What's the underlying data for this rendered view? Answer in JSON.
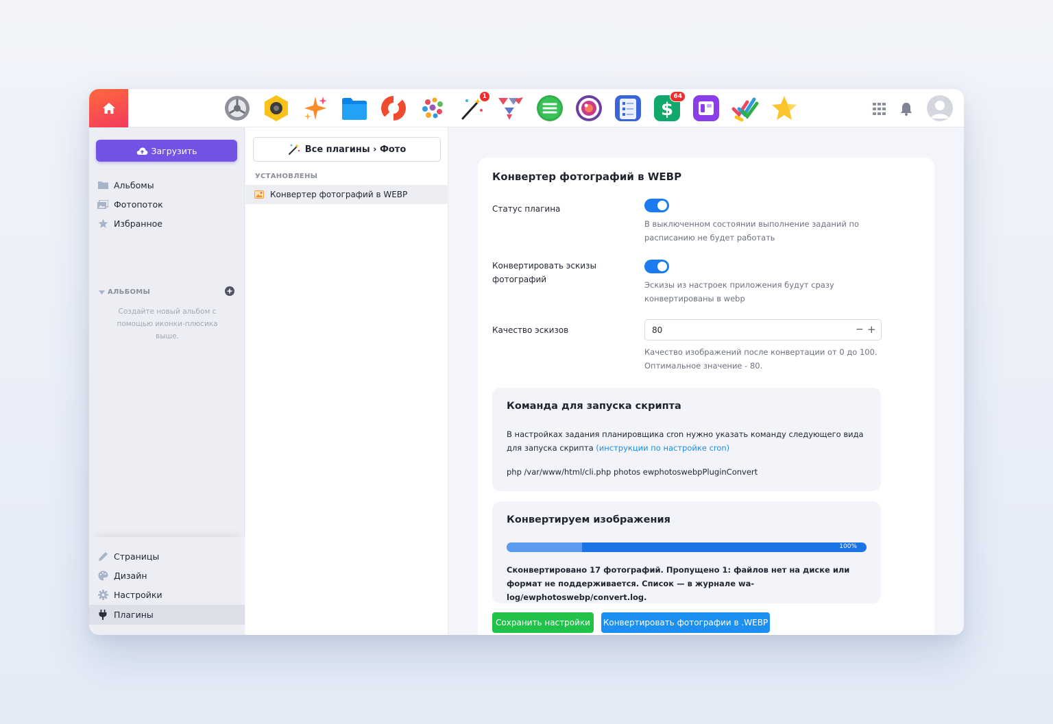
{
  "topbar": {
    "apps": [
      {
        "name": "settings-app-icon",
        "badge": ""
      },
      {
        "name": "camera-app-icon",
        "badge": ""
      },
      {
        "name": "sparkle-app-icon",
        "badge": ""
      },
      {
        "name": "files-app-icon",
        "badge": ""
      },
      {
        "name": "help-lifebuoy-app-icon",
        "badge": ""
      },
      {
        "name": "mosaic-app-icon",
        "badge": ""
      },
      {
        "name": "magic-wand-app-icon",
        "badge": "1"
      },
      {
        "name": "paper-planes-app-icon",
        "badge": ""
      },
      {
        "name": "menu-app-icon",
        "badge": ""
      },
      {
        "name": "lens-app-icon",
        "badge": ""
      },
      {
        "name": "forms-app-icon",
        "badge": ""
      },
      {
        "name": "dollar-app-icon",
        "badge": "64"
      },
      {
        "name": "widget-app-icon",
        "badge": ""
      },
      {
        "name": "checkmarks-app-icon",
        "badge": ""
      },
      {
        "name": "star-app-icon",
        "badge": ""
      }
    ]
  },
  "sidebar": {
    "upload_label": "Загрузить",
    "items": [
      {
        "label": "Альбомы"
      },
      {
        "label": "Фотопоток"
      },
      {
        "label": "Избранное"
      }
    ],
    "albums_heading": "АЛЬБОМЫ",
    "albums_hint": "Создайте новый альбом с помощью иконки-плюсика выше.",
    "bottom_items": [
      {
        "label": "Страницы"
      },
      {
        "label": "Дизайн"
      },
      {
        "label": "Настройки"
      },
      {
        "label": "Плагины"
      }
    ]
  },
  "plugins_pane": {
    "all_plugins_label": "Все плагины › Фото",
    "installed_heading": "УСТАНОВЛЕНЫ",
    "installed": [
      {
        "label": "Конвертер фотографий в WEBP"
      }
    ]
  },
  "settings": {
    "title": "Конвертер фотографий в WEBP",
    "plugin_status_label": "Статус плагина",
    "plugin_status_help": "В выключенном состоянии выполнение заданий по расписанию не будет работать",
    "thumbs_label": "Конвертировать эскизы фотографий",
    "thumbs_help": "Эскизы из настроек приложения будут сразу конвертированы в webp",
    "quality_label": "Качество эскизов",
    "quality_value": "80",
    "quality_help": "Качество изображений после конвертации от 0 до 100. Оптимальное значение - 80.",
    "cron": {
      "title": "Команда для запуска скрипта",
      "text": "В настройках задания планировщика cron нужно указать команду следующего вида для запуска скрипта",
      "link": "(инструкции по настройке cron)",
      "command": "php /var/www/html/cli.php photos ewphotoswebpPluginConvert"
    },
    "convert": {
      "title": "Конвертируем изображения",
      "progress_label": "100%",
      "progress": 1.0,
      "result": "Сконвертировано 17 фотографий. Пропущено 1: файлов нет на диске или формат не поддерживается. Список — в журнале wa-log/ewphotoswebp/convert.log."
    },
    "save_button": "Сохранить настройки",
    "convert_button": "Конвертировать фотографии в .WEBP"
  }
}
